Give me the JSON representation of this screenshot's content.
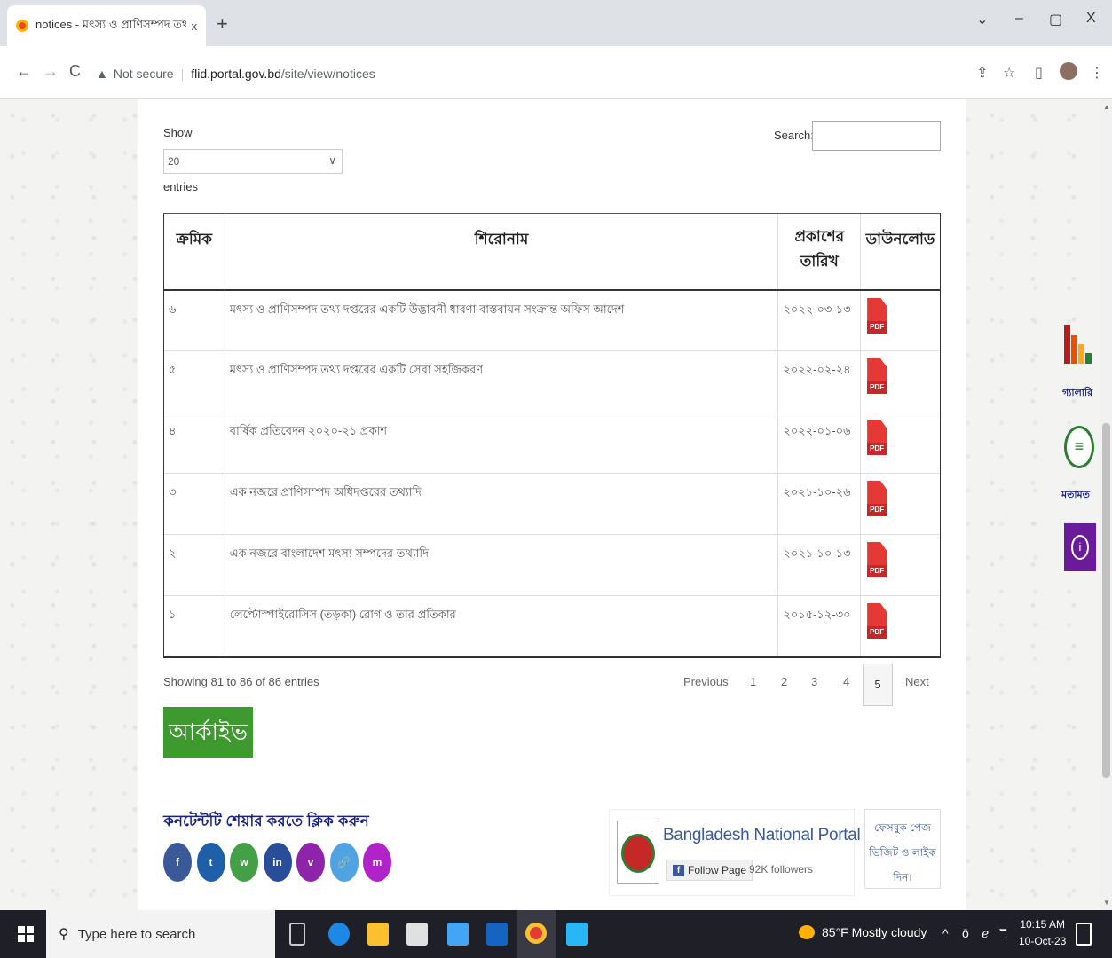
{
  "browser": {
    "tab_title": "notices - মৎস্য ও প্রাণিসম্পদ তথ্য",
    "tab_close": "x",
    "new_tab": "+",
    "win_min": "–",
    "win_max": "▢",
    "win_close": "X",
    "win_menu": "⌄",
    "security_label": "Not secure",
    "url_host": "flid.portal.gov.bd",
    "url_path": "/site/view/notices"
  },
  "controls": {
    "show_label": "Show",
    "entries_label": "entries",
    "page_size": "20",
    "search_label": "Search:",
    "search_value": ""
  },
  "table": {
    "headers": [
      "ক্রমিক",
      "শিরোনাম",
      "প্রকাশের তারিখ",
      "ডাউনলোড"
    ],
    "pdf_label": "PDF",
    "rows": [
      {
        "num": "৬",
        "title": "মৎস্য ও প্রাণিসম্পদ তথ্য দপ্তরের একটি উদ্ভাবনী ধারণা বাস্তবায়ন সংক্রান্ত অফিস আদেশ",
        "date": "২০২২-০৩-১৩"
      },
      {
        "num": "৫",
        "title": "মৎস্য ও প্রাণিসম্পদ তথ্য দপ্তরের একটি সেবা সহজিকরণ",
        "date": "২০২২-০২-২৪"
      },
      {
        "num": "৪",
        "title": "বার্ষিক প্রতিবেদন ২০২০-২১ প্রকাশ",
        "date": "২০২২-০১-০৬"
      },
      {
        "num": "৩",
        "title": "এক নজরে প্রাণিসম্পদ অধিদপ্তরের তথ্যাদি",
        "date": "২০২১-১০-২৬"
      },
      {
        "num": "২",
        "title": "এক নজরে বাংলাদেশ মৎস্য সম্পদের তথ্যাদি",
        "date": "২০২১-১০-১৩"
      },
      {
        "num": "১",
        "title": "লেপ্টোস্পাইরোসিস (তড়কা) রোগ ও তার প্রতিকার",
        "date": "২০১৫-১২-৩০"
      }
    ]
  },
  "pagination": {
    "info": "Showing 81 to 86 of 86 entries",
    "previous": "Previous",
    "pages": [
      "1",
      "2",
      "3",
      "4"
    ],
    "current": "5",
    "next": "Next"
  },
  "archive_label": "আর্কাইভ",
  "share": {
    "title": "কনটেন্টটি শেয়ার করতে ক্লিক করুন",
    "buttons": [
      {
        "name": "facebook",
        "glyph": "f",
        "color": "#3b5998"
      },
      {
        "name": "twitter",
        "glyph": "t",
        "color": "#1e5fa8"
      },
      {
        "name": "whatsapp",
        "glyph": "w",
        "color": "#43a047"
      },
      {
        "name": "linkedin",
        "glyph": "in",
        "color": "#2a4d9a"
      },
      {
        "name": "viber",
        "glyph": "v",
        "color": "#8e24aa"
      },
      {
        "name": "link",
        "glyph": "🔗",
        "color": "#4fa3e0"
      },
      {
        "name": "messenger",
        "glyph": "m",
        "color": "#b023c9"
      }
    ]
  },
  "facebook": {
    "page_name": "Bangladesh National Portal",
    "follow_label": "Follow Page",
    "followers": "92K followers",
    "message": [
      "ফেসবুক পেজ",
      "ভিজিট ও লাইক",
      "দিন।"
    ]
  },
  "side": {
    "gallery_label": "গ্যালারি",
    "feedback_label": "মতামত",
    "accessibility_glyph": "i"
  },
  "taskbar": {
    "search_placeholder": "Type here to search",
    "weather": "85°F  Mostly cloudy",
    "time": "10:15 AM",
    "date": "10-Oct-23"
  }
}
